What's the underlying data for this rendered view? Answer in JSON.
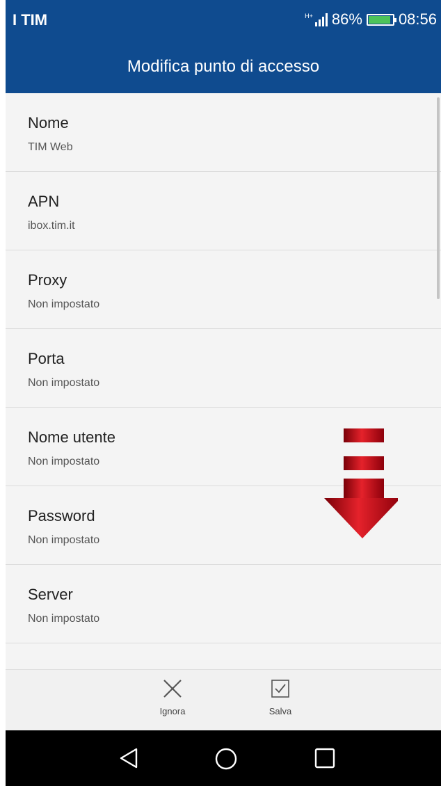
{
  "status_bar": {
    "carrier": "I TIM",
    "network_type": "H+",
    "battery_percent": "86%",
    "battery_level": 0.86,
    "time": "08:56"
  },
  "title_bar": {
    "title": "Modifica punto di accesso"
  },
  "settings": [
    {
      "label": "Nome",
      "value": "TIM Web"
    },
    {
      "label": "APN",
      "value": "ibox.tim.it"
    },
    {
      "label": "Proxy",
      "value": "Non impostato"
    },
    {
      "label": "Porta",
      "value": "Non impostato"
    },
    {
      "label": "Nome utente",
      "value": "Non impostato"
    },
    {
      "label": "Password",
      "value": "Non impostato"
    },
    {
      "label": "Server",
      "value": "Non impostato"
    }
  ],
  "actions": {
    "discard_label": "Ignora",
    "save_label": "Salva",
    "discard_icon": "close-icon",
    "save_icon": "checkbox-icon"
  },
  "nav_bar": {
    "back_icon": "back-triangle-icon",
    "home_icon": "home-circle-icon",
    "recents_icon": "recents-square-icon"
  },
  "colors": {
    "header": "#0f4b8f",
    "arrow": "#c8111a",
    "battery_fill": "#4cc35a"
  }
}
